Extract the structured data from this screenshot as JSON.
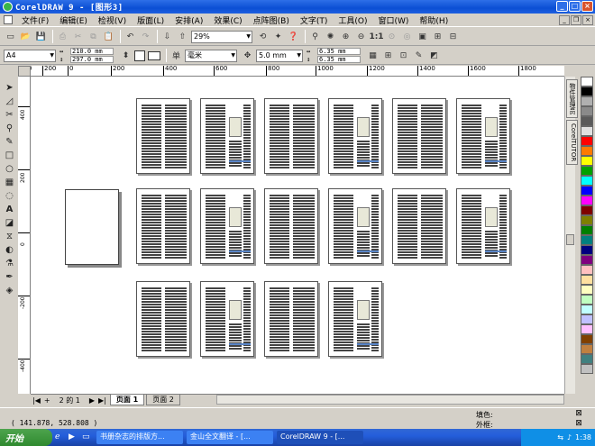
{
  "window": {
    "title": "CorelDRAW 9 - [图形3]"
  },
  "menu": {
    "items": [
      "文件(F)",
      "编辑(E)",
      "检视(V)",
      "版面(L)",
      "安排(A)",
      "效果(C)",
      "点阵图(B)",
      "文字(T)",
      "工具(O)",
      "窗口(W)",
      "帮助(H)"
    ]
  },
  "toolbar": {
    "zoom": "29%"
  },
  "propbar": {
    "paper": "A4",
    "width": "210.0 mm",
    "height": "297.0 mm",
    "units": "毫米",
    "nudge": "5.0 mm",
    "dup_x": "6.35 mm",
    "dup_y": "6.35 mm"
  },
  "ruler": {
    "h_ticks": [
      "400",
      "200",
      "0",
      "200",
      "400",
      "600",
      "800",
      "1000",
      "1200",
      "1400",
      "1600",
      "1800"
    ],
    "v_ticks": [
      "400",
      "200",
      "0",
      "-200",
      "-400"
    ]
  },
  "dockers": {
    "tabs": [
      "物件管理员",
      "CorelTUTOR"
    ]
  },
  "palette": {
    "colors": [
      "#ffffff",
      "#000000",
      "#b0b0b0",
      "#8a8a8a",
      "#5a5a5a",
      "#e0e0e0",
      "#ff0000",
      "#ff7a00",
      "#ffff00",
      "#00a000",
      "#00ffff",
      "#0000ff",
      "#ff00ff",
      "#7f0000",
      "#7f7f00",
      "#007f00",
      "#007f7f",
      "#00007f",
      "#7f007f",
      "#ffc0c0",
      "#ffe0a0",
      "#ffffc0",
      "#c0ffc0",
      "#c0ffff",
      "#c0c0ff",
      "#ffc0ff",
      "#804000",
      "#c08040",
      "#408080",
      "#c0c0c0"
    ]
  },
  "pagebar": {
    "counter": "2 的 1",
    "tabs": [
      "页面 1",
      "页面 2"
    ]
  },
  "status": {
    "coords": "( 141.878, 528.808 )",
    "fill_label": "填色:",
    "outline_label": "外框:"
  },
  "taskbar": {
    "start": "开始",
    "tasks": [
      "书册杂志的排版方...",
      "金山全文翻译 - [...",
      "CorelDRAW 9 - [..."
    ],
    "clock": "1:38"
  }
}
